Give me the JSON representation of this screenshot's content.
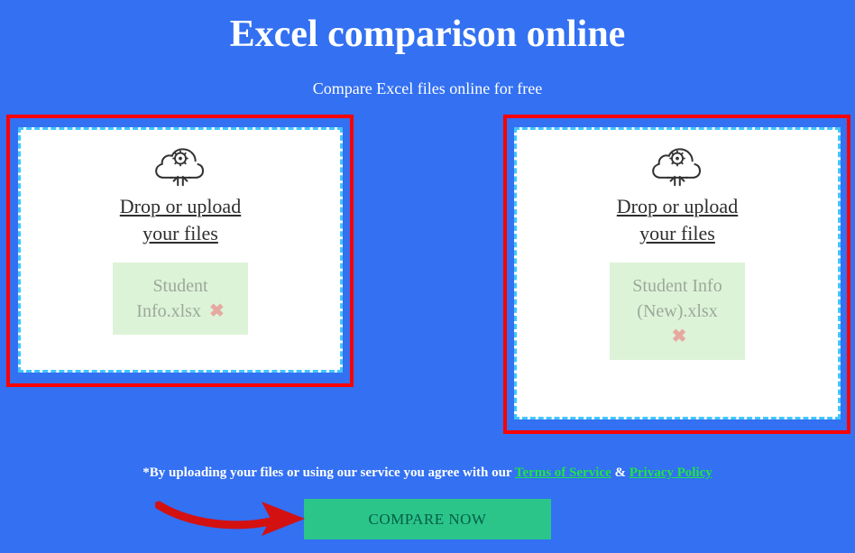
{
  "title": "Excel comparison online",
  "subtitle": "Compare Excel files online for free",
  "drop_label_line1": "Drop or upload",
  "drop_label_line2": "your files",
  "files": {
    "left": "Student Info.xlsx",
    "right": "Student Info (New).xlsx"
  },
  "remove_symbol": "✖",
  "legal": {
    "prefix": "*By uploading your files or using our service you agree with our ",
    "tos": "Terms of Service",
    "amp": " & ",
    "privacy": "Privacy Policy"
  },
  "compare_label": "COMPARE NOW"
}
